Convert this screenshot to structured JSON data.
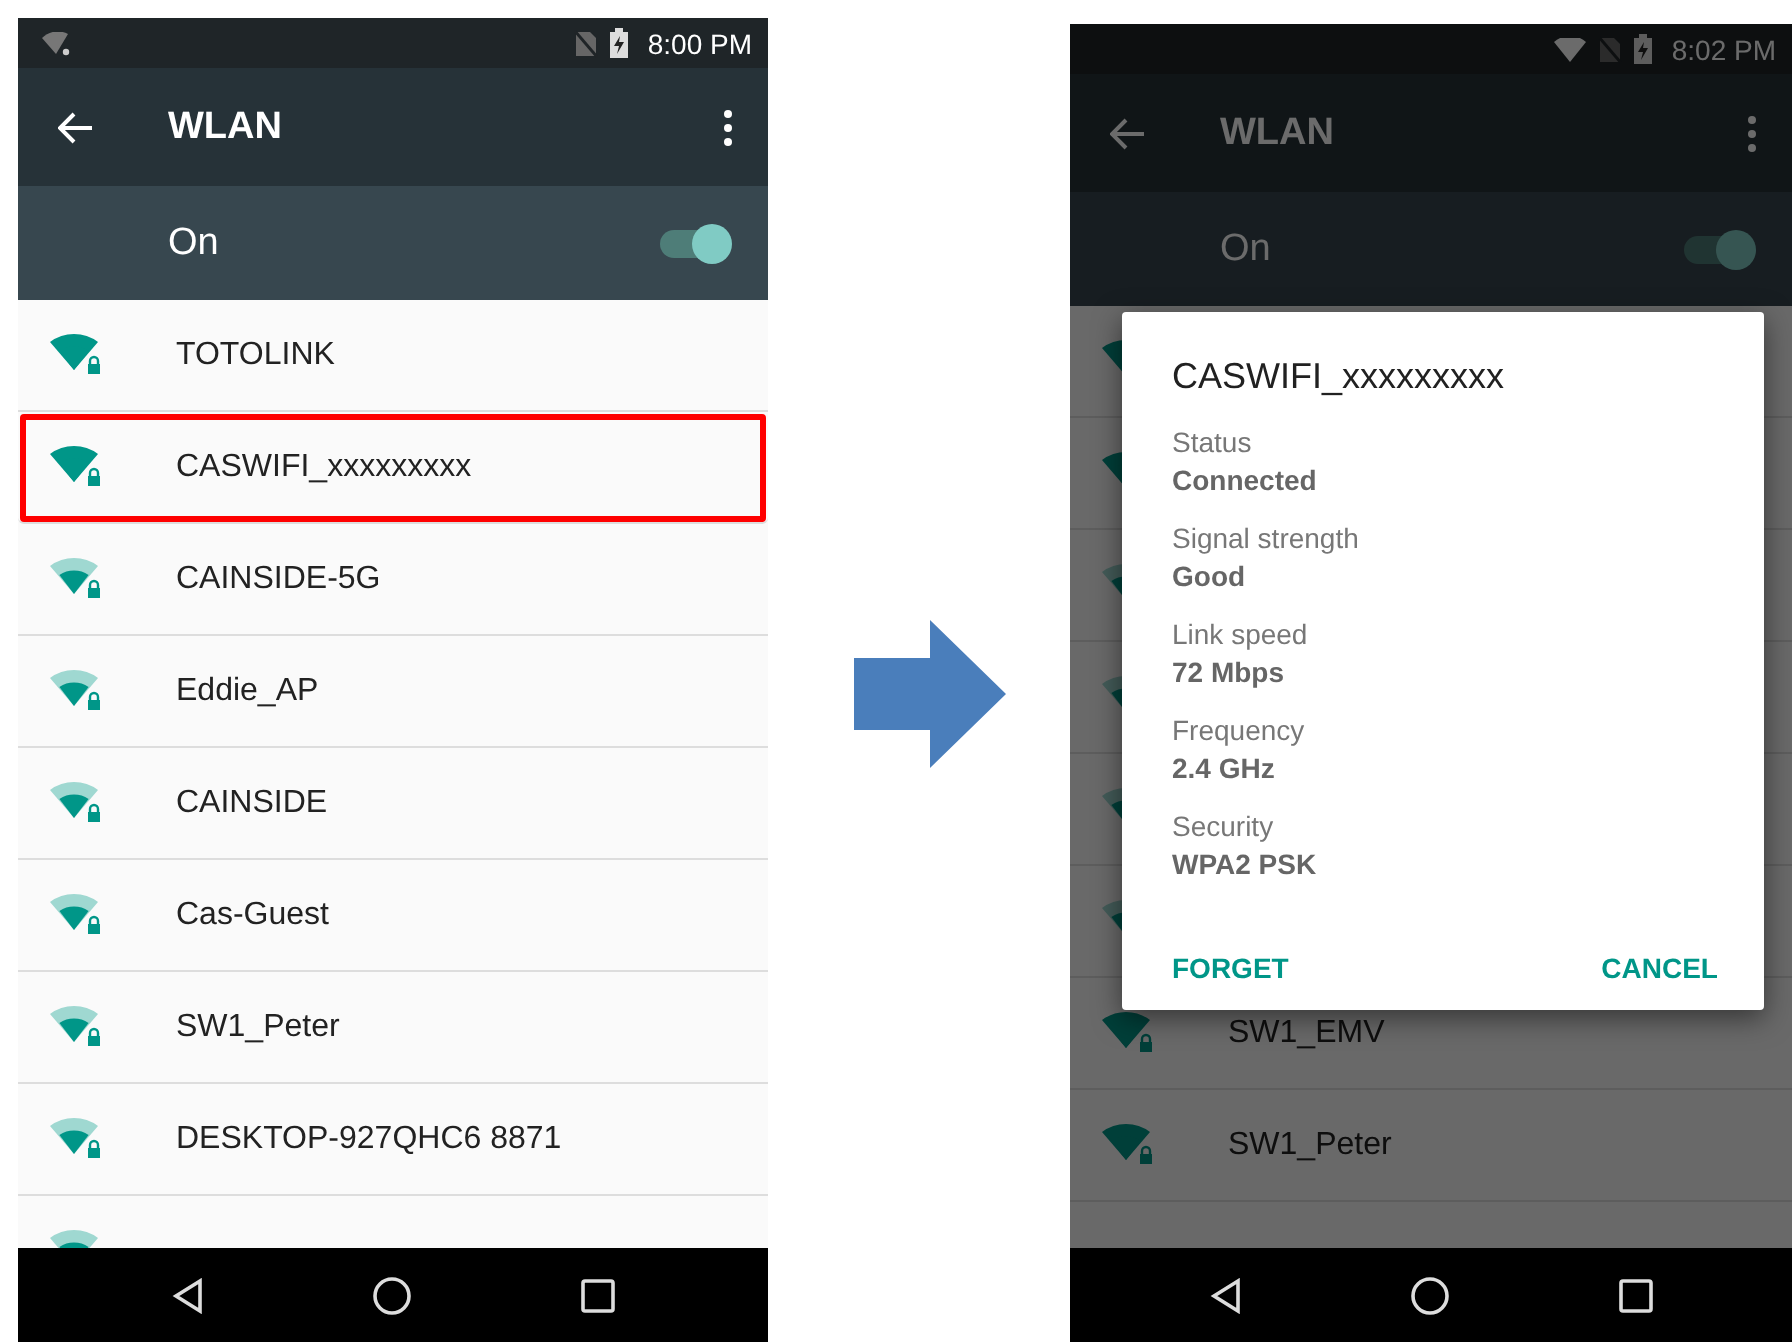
{
  "screens": [
    {
      "dimmed": false,
      "status_bar": {
        "time": "8:00 PM",
        "wifi_connected": false
      },
      "app_bar": {
        "title": "WLAN"
      },
      "master_switch": {
        "label": "On",
        "on": true
      },
      "networks": [
        {
          "kind": "network",
          "name": "TOTOLINK",
          "strong": true,
          "highlighted": false
        },
        {
          "kind": "network",
          "name": "CASWIFI_xxxxxxxxx",
          "strong": true,
          "highlighted": true
        },
        {
          "kind": "network",
          "name": "CAINSIDE-5G",
          "strong": false,
          "highlighted": false
        },
        {
          "kind": "network",
          "name": "Eddie_AP",
          "strong": false,
          "highlighted": false
        },
        {
          "kind": "network",
          "name": "CAINSIDE",
          "strong": false,
          "highlighted": false
        },
        {
          "kind": "network",
          "name": "Cas-Guest",
          "strong": false,
          "highlighted": false
        },
        {
          "kind": "network",
          "name": "SW1_Peter",
          "strong": false,
          "highlighted": false
        },
        {
          "kind": "network",
          "name": "DESKTOP-927QHC6 8871",
          "strong": false,
          "highlighted": false
        },
        {
          "kind": "covered",
          "strong": false,
          "highlighted": false
        }
      ]
    },
    {
      "dimmed": true,
      "status_bar": {
        "time": "8:02 PM",
        "wifi_connected": true
      },
      "app_bar": {
        "title": "WLAN"
      },
      "master_switch": {
        "label": "On",
        "on": true
      },
      "networks": [
        {
          "kind": "covered",
          "strong": true,
          "highlighted": false
        },
        {
          "kind": "covered",
          "strong": true,
          "highlighted": false
        },
        {
          "kind": "covered",
          "strong": false,
          "highlighted": false
        },
        {
          "kind": "covered",
          "strong": false,
          "highlighted": false
        },
        {
          "kind": "covered",
          "strong": false,
          "highlighted": false
        },
        {
          "kind": "covered",
          "strong": false,
          "highlighted": false
        },
        {
          "kind": "network",
          "name": "SW1_EMV",
          "strong": true,
          "highlighted": false
        },
        {
          "kind": "network",
          "name": "SW1_Peter",
          "strong": true,
          "highlighted": false
        }
      ],
      "dialog": {
        "title": "CASWIFI_xxxxxxxxx",
        "fields": [
          {
            "label": "Status",
            "value": "Connected"
          },
          {
            "label": "Signal strength",
            "value": "Good"
          },
          {
            "label": "Link speed",
            "value": "72 Mbps"
          },
          {
            "label": "Frequency",
            "value": "2.4 GHz"
          },
          {
            "label": "Security",
            "value": "WPA2 PSK"
          }
        ],
        "buttons": [
          "FORGET",
          "CANCEL"
        ]
      }
    }
  ]
}
